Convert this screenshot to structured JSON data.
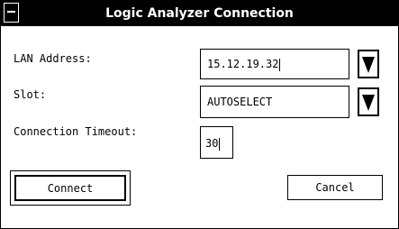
{
  "window": {
    "title": "Logic Analyzer Connection"
  },
  "form": {
    "lan_address": {
      "label": "LAN Address:",
      "value": "15.12.19.32"
    },
    "slot": {
      "label": "Slot:",
      "value": "AUTOSELECT"
    },
    "timeout": {
      "label": "Connection Timeout:",
      "value": "30"
    }
  },
  "buttons": {
    "connect": "Connect",
    "cancel": "Cancel"
  },
  "icons": {
    "system_menu": "window-menu-icon",
    "dropdown": "triangle-down-icon"
  },
  "colors": {
    "titlebar_bg": "#000000",
    "titlebar_fg": "#ffffff",
    "window_bg": "#ffffff"
  }
}
